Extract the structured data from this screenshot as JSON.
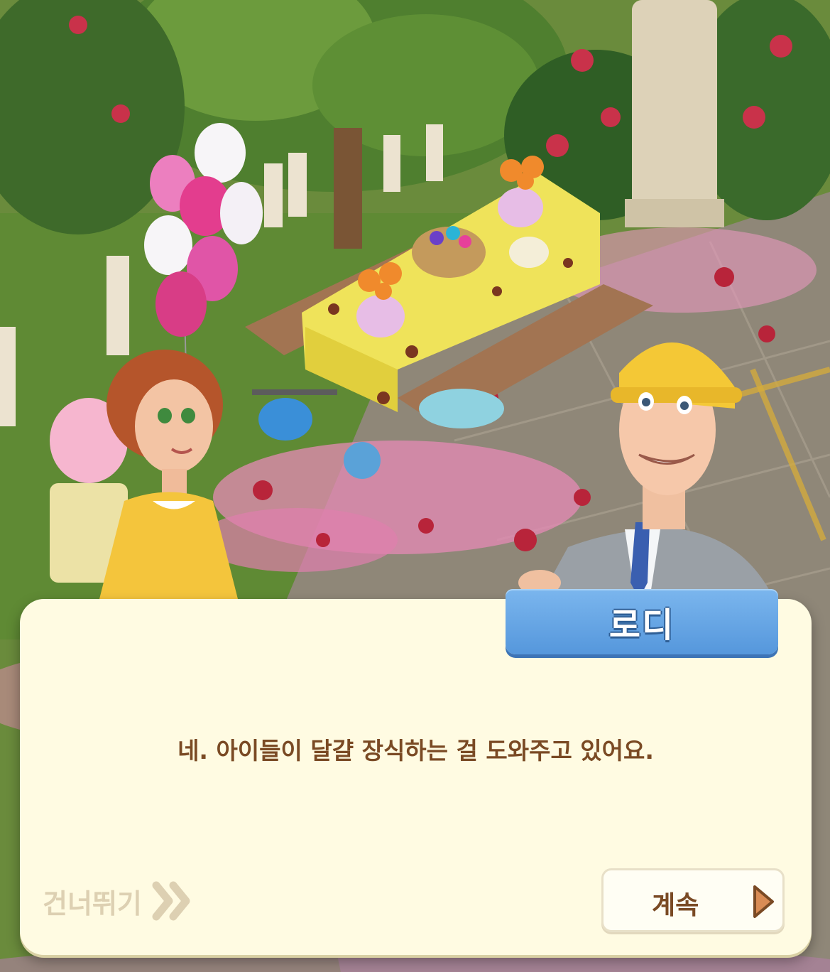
{
  "dialog": {
    "speaker": "로디",
    "message": "네. 아이들이 달걀 장식하는 걸 도와주고 있어요.",
    "skip_label": "건너뛰기",
    "continue_label": "계속"
  },
  "colors": {
    "dialog_bg": "#fffbe2",
    "name_tag": "#5f9fe2",
    "message_text": "#7a4a24",
    "skip_text": "#ddd0b2",
    "continue_arrow": "#d98c55"
  },
  "icons": {
    "skip": "double-chevron-right-icon",
    "continue": "play-triangle-icon"
  }
}
